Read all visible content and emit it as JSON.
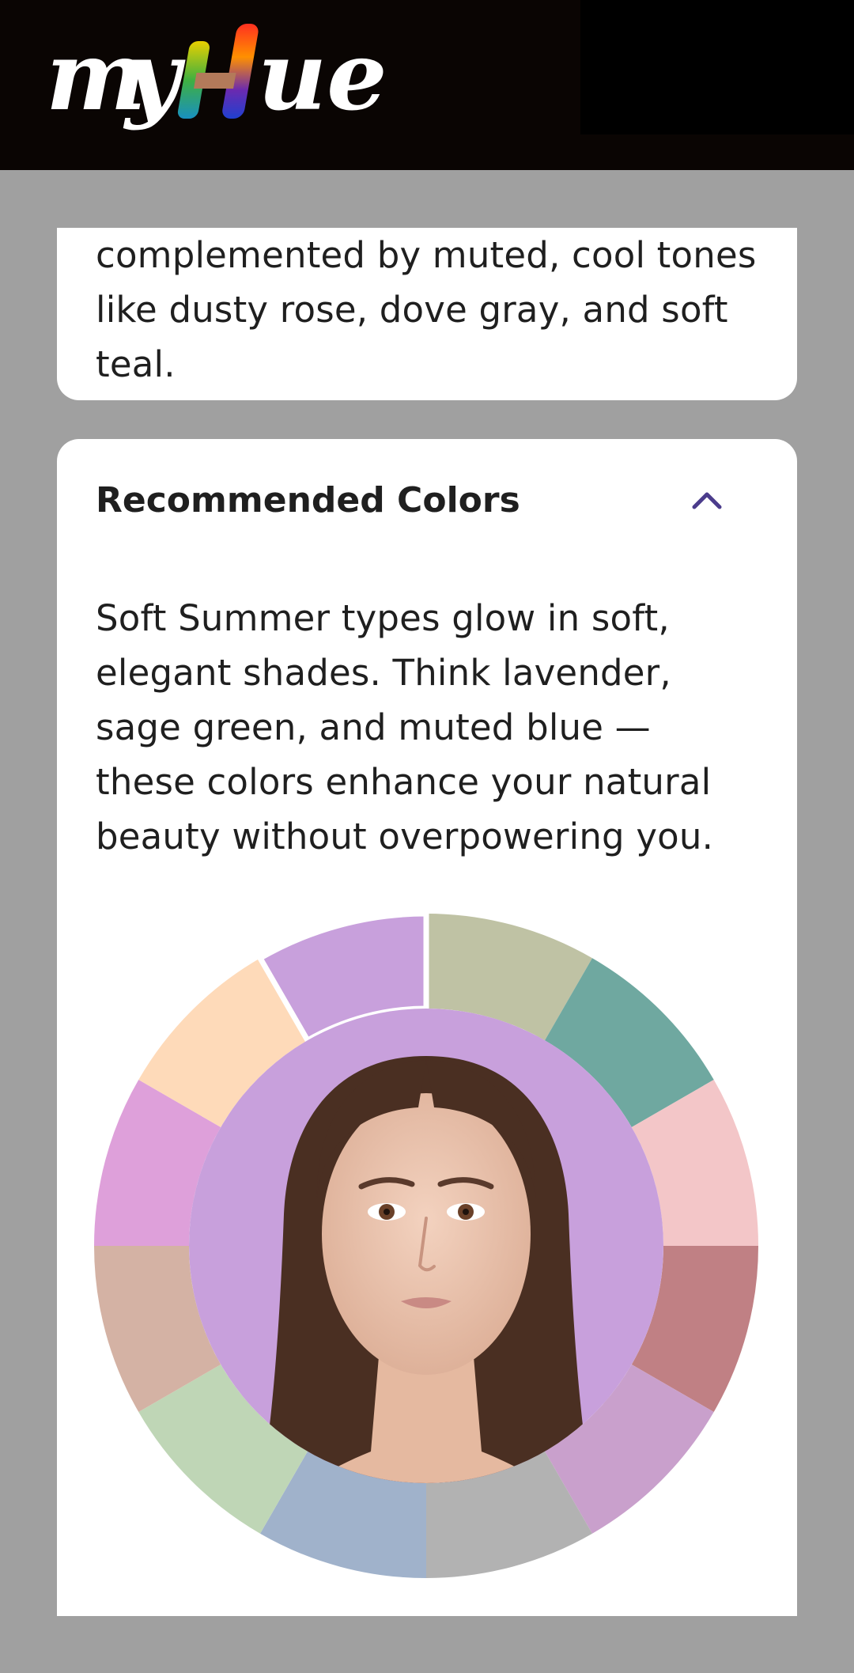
{
  "header": {
    "logo_text": "myHue"
  },
  "overview": {
    "text_tail": "complemented by muted, cool tones like dusty rose, dove gray, and soft teal."
  },
  "recommended": {
    "title": "Recommended Colors",
    "expanded": true,
    "description": "Soft Summer types glow in soft, elegant shades. Think lavender, sage green, and muted blue — these colors enhance your natural beauty without overpowering you.",
    "center_color": "#c8a0dc",
    "swatches": [
      {
        "color": "#bfc2a4",
        "selected": false
      },
      {
        "color": "#6fa8a0",
        "selected": false
      },
      {
        "color": "#f3c6c8",
        "selected": false
      },
      {
        "color": "#c08084",
        "selected": false
      },
      {
        "color": "#c9a0cc",
        "selected": false
      },
      {
        "color": "#b2b2b2",
        "selected": false
      },
      {
        "color": "#a0b2cb",
        "selected": false
      },
      {
        "color": "#bfd6b6",
        "selected": false
      },
      {
        "color": "#d4b2a4",
        "selected": false
      },
      {
        "color": "#dea0da",
        "selected": false
      },
      {
        "color": "#fedab9",
        "selected": false
      },
      {
        "color": "#c8a0dc",
        "selected": true
      }
    ]
  }
}
